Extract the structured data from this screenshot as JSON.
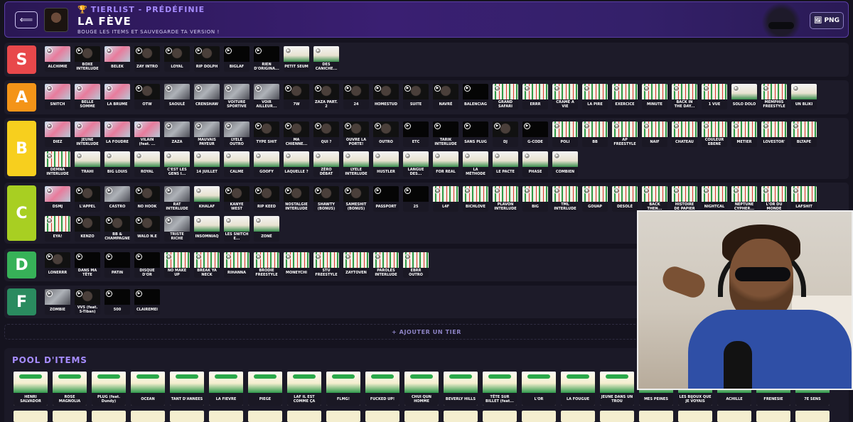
{
  "header": {
    "kicker": "TIERLIST - PRÉDÉFINIE",
    "title": "LA FÈVE",
    "subtitle": "BOUGE LES ITEMS ET SAUVEGARDE TA VERSION !",
    "export_label": "PNG"
  },
  "colors": {
    "S": "#e8484b",
    "A": "#f49418",
    "B": "#f7cf1e",
    "C": "#a8cf22",
    "D": "#37b158",
    "F": "#2a8b5f"
  },
  "tiers": [
    {
      "label": "S",
      "items": [
        {
          "t": "ALCHIMIE",
          "c": "pink"
        },
        {
          "t": "BOXE INTERLUDE",
          "c": "dark"
        },
        {
          "t": "BELEK",
          "c": "pink"
        },
        {
          "t": "ZAY INTRO",
          "c": "dark"
        },
        {
          "t": "LOYAL",
          "c": "dark"
        },
        {
          "t": "RIP DOLPH",
          "c": "dark"
        },
        {
          "t": "BIGLAF",
          "c": "black"
        },
        {
          "t": "RIEN D'ORIGINA...",
          "c": "black"
        },
        {
          "t": "PETIT SEUM",
          "c": "white"
        },
        {
          "t": "DES CANICHE...",
          "c": "white"
        }
      ]
    },
    {
      "label": "A",
      "items": [
        {
          "t": "SNITCH",
          "c": "pink"
        },
        {
          "t": "BELLE SOMME",
          "c": "pink"
        },
        {
          "t": "LA BRUME",
          "c": "pink"
        },
        {
          "t": "OTW",
          "c": "dark"
        },
        {
          "t": "SAOULÉ",
          "c": "grey"
        },
        {
          "t": "CRENSHAW",
          "c": "grey"
        },
        {
          "t": "VOITURE SPORTIVE",
          "c": "grey"
        },
        {
          "t": "VOIR AILLEUR...",
          "c": "grey"
        },
        {
          "t": "7W",
          "c": "dark"
        },
        {
          "t": "ZAZA PART. 2",
          "c": "dark"
        },
        {
          "t": "24",
          "c": "dark"
        },
        {
          "t": "HOMESTUD",
          "c": "dark"
        },
        {
          "t": "SUITE",
          "c": "dark"
        },
        {
          "t": "NAVRÉ",
          "c": "dark"
        },
        {
          "t": "BALENCIAG",
          "c": "black"
        },
        {
          "t": "GRAND SAFARI",
          "c": "green"
        },
        {
          "t": "ERRR",
          "c": "green"
        },
        {
          "t": "CRAMÉ A VIE",
          "c": "green"
        },
        {
          "t": "LA PIRE",
          "c": "green"
        },
        {
          "t": "EXERCICE",
          "c": "green"
        },
        {
          "t": "MINUTE",
          "c": "green"
        },
        {
          "t": "BACK IN THE DAY...",
          "c": "green"
        },
        {
          "t": "1 VUE",
          "c": "green"
        },
        {
          "t": "SOLO DOLO",
          "c": "white"
        },
        {
          "t": "MEMPHIS FREESTYLE",
          "c": "green"
        },
        {
          "t": "UN BLIKI",
          "c": "white"
        }
      ]
    },
    {
      "label": "B",
      "items": [
        {
          "t": "DIEZ",
          "c": "pink"
        },
        {
          "t": "JEUNE INTERLUDE",
          "c": "pink"
        },
        {
          "t": "LA FOUDRE",
          "c": "pink"
        },
        {
          "t": "VILAIN (feat. ...",
          "c": "pink"
        },
        {
          "t": "ZAZA",
          "c": "grey"
        },
        {
          "t": "MAUVAIS PAYEUR",
          "c": "grey"
        },
        {
          "t": "LYELE OUTRO",
          "c": "grey"
        },
        {
          "t": "TYPE SHIT",
          "c": "dark"
        },
        {
          "t": "MA CHIENNE...",
          "c": "dark"
        },
        {
          "t": "QUI ?",
          "c": "dark"
        },
        {
          "t": "OUVRE LA PORTE!",
          "c": "dark"
        },
        {
          "t": "OUTRO",
          "c": "dark"
        },
        {
          "t": "ETC",
          "c": "black"
        },
        {
          "t": "TARIK INTERLUDE",
          "c": "black"
        },
        {
          "t": "SANS PLUG",
          "c": "black"
        },
        {
          "t": "DJ",
          "c": "dark"
        },
        {
          "t": "G-CODE",
          "c": "black"
        },
        {
          "t": "POLI",
          "c": "green"
        },
        {
          "t": "BB",
          "c": "green"
        },
        {
          "t": "AP FREESTYLE",
          "c": "green"
        },
        {
          "t": "NAIF",
          "c": "green"
        },
        {
          "t": "CHATEAU",
          "c": "green"
        },
        {
          "t": "COULEUR EBENE",
          "c": "green"
        },
        {
          "t": "METIER",
          "c": "green"
        },
        {
          "t": "LOVESTOR'",
          "c": "green"
        },
        {
          "t": "BLTAPE",
          "c": "green"
        },
        {
          "t": "DEMNA INTERLUDE",
          "c": "green"
        },
        {
          "t": "TRAHI",
          "c": "white"
        },
        {
          "t": "BIG LOUIS",
          "c": "white"
        },
        {
          "t": "ROYAL",
          "c": "white"
        },
        {
          "t": "C'EST LES GENS I...",
          "c": "white"
        },
        {
          "t": "14 JUILLET",
          "c": "white"
        },
        {
          "t": "CALME",
          "c": "white"
        },
        {
          "t": "GOOFY",
          "c": "white"
        },
        {
          "t": "LAQUELLE ?",
          "c": "white"
        },
        {
          "t": "ZÉRO DÉBAT",
          "c": "white"
        },
        {
          "t": "LYELE INTERLUDE",
          "c": "white"
        },
        {
          "t": "HUSTLER",
          "c": "white"
        },
        {
          "t": "LANGUE DES...",
          "c": "white"
        },
        {
          "t": "FOR REAL",
          "c": "white"
        },
        {
          "t": "LA MÉTHODE",
          "c": "white"
        },
        {
          "t": "LE PACTE",
          "c": "white"
        },
        {
          "t": "PHASE",
          "c": "white"
        },
        {
          "t": "COMBIEN",
          "c": "white"
        }
      ]
    },
    {
      "label": "C",
      "items": [
        {
          "t": "DSMJ",
          "c": "pink"
        },
        {
          "t": "L'APPEL",
          "c": "dark"
        },
        {
          "t": "CASTRO",
          "c": "grey"
        },
        {
          "t": "NO HOOK",
          "c": "dark"
        },
        {
          "t": "RAT INTERLUDE",
          "c": "grey"
        },
        {
          "t": "KHALAF",
          "c": "white"
        },
        {
          "t": "KANYE WEST",
          "c": "dark"
        },
        {
          "t": "RIP KEED",
          "c": "dark"
        },
        {
          "t": "NOSTALGIE INTERLUDE",
          "c": "dark"
        },
        {
          "t": "SHAWTY (BONUS)",
          "c": "dark"
        },
        {
          "t": "SAMESHIT (BONUS)",
          "c": "dark"
        },
        {
          "t": "PASSPORT",
          "c": "black"
        },
        {
          "t": "25",
          "c": "black"
        },
        {
          "t": "L4F",
          "c": "green"
        },
        {
          "t": "BICHLOVE",
          "c": "green"
        },
        {
          "t": "PLAVON INTERLUDE",
          "c": "green"
        },
        {
          "t": "BIG",
          "c": "green"
        },
        {
          "t": "TML INTERLUDE",
          "c": "green"
        },
        {
          "t": "GOUAP",
          "c": "green"
        },
        {
          "t": "DESOLÉ",
          "c": "green"
        },
        {
          "t": "BACK THEN...",
          "c": "green"
        },
        {
          "t": "HISTOIRE DE PAPIER",
          "c": "green"
        },
        {
          "t": "NIGHTCAL",
          "c": "green"
        },
        {
          "t": "NEPTUNE CYPHER...",
          "c": "green"
        },
        {
          "t": "L'OR DU MONDE",
          "c": "green"
        },
        {
          "t": "LAFSHIT",
          "c": "green"
        },
        {
          "t": "EYA!",
          "c": "green"
        },
        {
          "t": "KENZO",
          "c": "dark"
        },
        {
          "t": "BB & CHAMPAGNE",
          "c": "dark"
        },
        {
          "t": "WALO N.E",
          "c": "dark"
        },
        {
          "t": "TRISTE RICHE",
          "c": "grey"
        },
        {
          "t": "INSOMNIAQ",
          "c": "white"
        },
        {
          "t": "LES SNITCH E...",
          "c": "white"
        },
        {
          "t": "ZONÉ",
          "c": "white"
        }
      ]
    },
    {
      "label": "D",
      "items": [
        {
          "t": "LONERRR",
          "c": "dark"
        },
        {
          "t": "DANS MA TÊTE",
          "c": "black"
        },
        {
          "t": "PATIN",
          "c": "black"
        },
        {
          "t": "DISQUE D'OR",
          "c": "black"
        },
        {
          "t": "NO MAKE UP",
          "c": "green"
        },
        {
          "t": "BREAK YA NECK",
          "c": "green"
        },
        {
          "t": "RIHANNA",
          "c": "green"
        },
        {
          "t": "BRODIE FREESTYLE",
          "c": "green"
        },
        {
          "t": "MONEYCHI",
          "c": "green"
        },
        {
          "t": "STU FREESTYLE",
          "c": "green"
        },
        {
          "t": "ZAYTOVEN",
          "c": "green"
        },
        {
          "t": "PAROLES INTERLUDE",
          "c": "green"
        },
        {
          "t": "EBRR OUTRO",
          "c": "green"
        }
      ]
    },
    {
      "label": "F",
      "items": [
        {
          "t": "ZOMBIE",
          "c": "grey"
        },
        {
          "t": "VVS (feat. S-Tiban)",
          "c": "dark"
        },
        {
          "t": "500",
          "c": "black"
        },
        {
          "t": "CLAIREMEI",
          "c": "black"
        }
      ]
    }
  ],
  "add_tier_label": "+ AJOUTER UN TIER",
  "pool": {
    "title": "POOL D'ITEMS",
    "items": [
      "HENRI SALVADOR",
      "ROSE MAGNOLIA",
      "PLUG (feat. Dundy)",
      "OCEAN",
      "TANT D'ANNEES",
      "LA FIEVRE",
      "PIEGE",
      "LAF IL EST COMME ÇA",
      "FLMG!",
      "FUCKED UP!",
      "CHUI QUN HOMME",
      "BEVERLY HILLS",
      "TÊTE SUR BILLET (feat...",
      "L'OR",
      "LA FOUGUE",
      "JEUNE DANS UN TROU",
      "MES PEINES",
      "LES BIJOUX QUE JE VOYAIS",
      "ACHILLE",
      "FRENESIE",
      "7E SENS"
    ]
  }
}
